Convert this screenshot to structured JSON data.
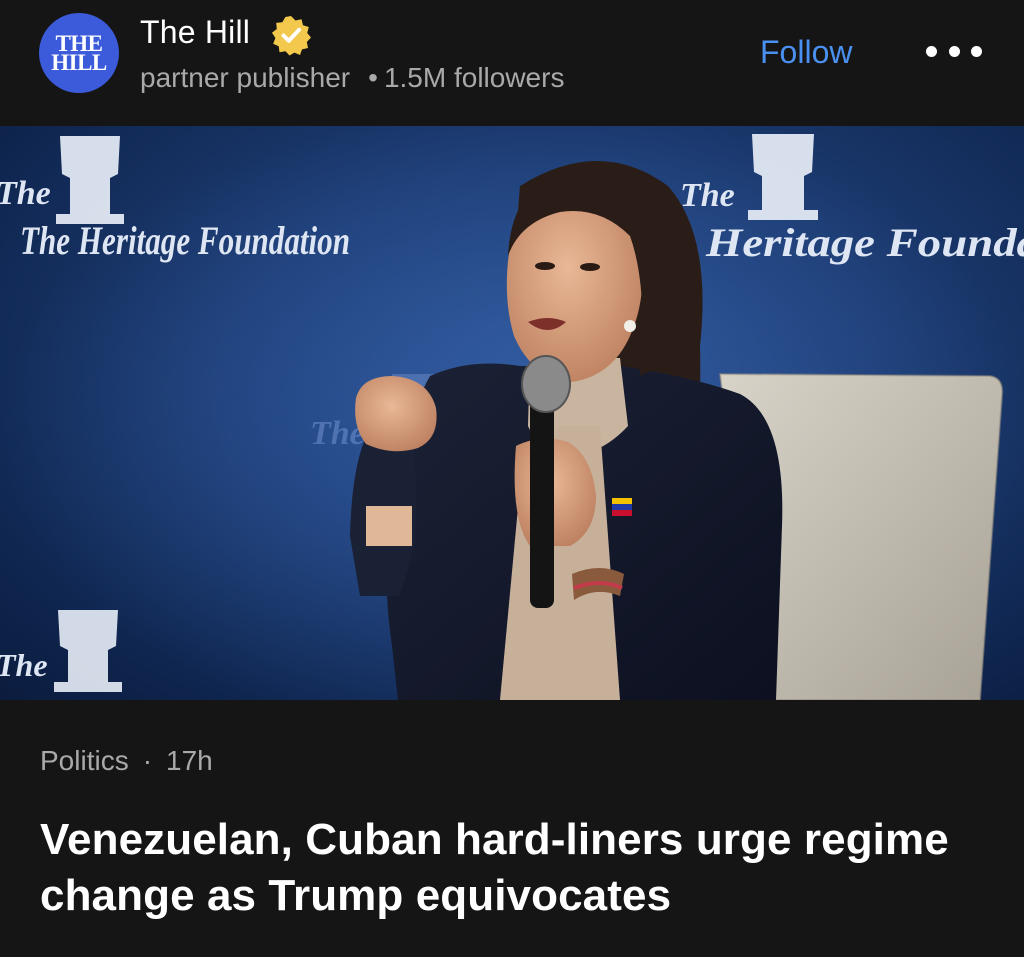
{
  "publisher": {
    "logo_line1": "THE",
    "logo_line2": "HILL",
    "name": "The Hill",
    "role": "partner publisher",
    "followers": "1.5M followers",
    "follow_label": "Follow",
    "accent_color": "#4a90f0",
    "verified_badge_color": "#f2c94c"
  },
  "image": {
    "backdrop_text": "The Heritage Foundation"
  },
  "article": {
    "category": "Politics",
    "age": "17h",
    "headline": "Venezuelan, Cuban hard-liners urge regime change as Trump equivocates"
  },
  "icons": {
    "verified": "verified-badge-icon",
    "more": "more-options-icon"
  }
}
